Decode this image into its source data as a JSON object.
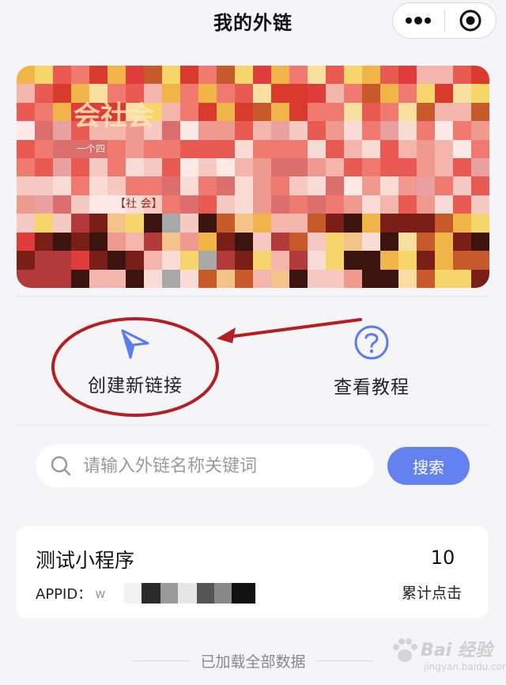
{
  "nav": {
    "title": "我的外链"
  },
  "banner": {
    "text_large": "会社会",
    "text_small": "一个四",
    "text_tag": "【社 会】"
  },
  "actions": [
    {
      "label": "创建新链接",
      "icon": "send-icon",
      "color": "#5b7cf0"
    },
    {
      "label": "查看教程",
      "icon": "question-circle-icon",
      "color": "#5b7cf0"
    }
  ],
  "annotation": {
    "color": "#b51e24"
  },
  "search": {
    "placeholder": "请输入外链名称关键词",
    "value": "",
    "button_label": "搜索",
    "button_color": "#6482ef"
  },
  "list": [
    {
      "name": "测试小程序",
      "appid_label": "APPID：",
      "appid_visible": "w",
      "count": "10",
      "count_label": "累计点击"
    }
  ],
  "footer": {
    "text": "已加载全部数据"
  },
  "watermark": {
    "text": "Bai 经验",
    "sub": "jingyan.baidu.com"
  }
}
